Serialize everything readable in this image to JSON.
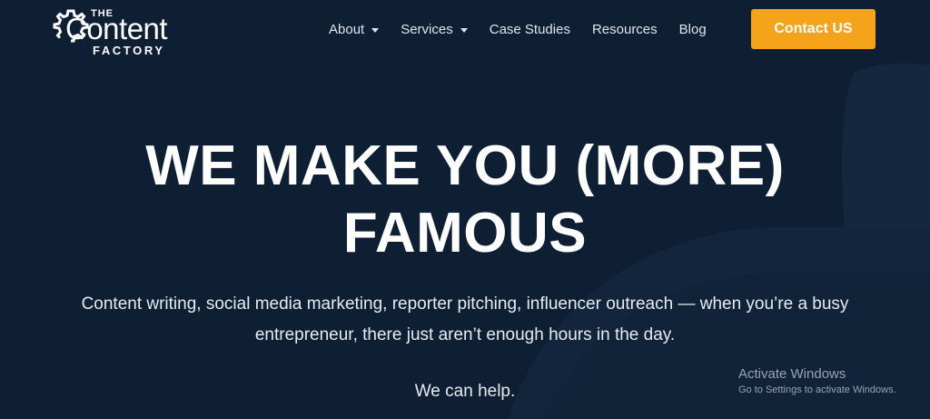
{
  "colors": {
    "background": "#0f1f33",
    "accent": "#f5a31b",
    "text": "#ffffff"
  },
  "logo": {
    "top_word": "THE",
    "main_word": "Content",
    "bottom_word": "FACTORY",
    "icon": "gear-icon"
  },
  "nav": {
    "items": [
      {
        "label": "About",
        "has_dropdown": true
      },
      {
        "label": "Services",
        "has_dropdown": true
      },
      {
        "label": "Case Studies",
        "has_dropdown": false
      },
      {
        "label": "Resources",
        "has_dropdown": false
      },
      {
        "label": "Blog",
        "has_dropdown": false
      }
    ],
    "cta_label": "Contact US"
  },
  "hero": {
    "title_line1": "WE MAKE YOU (MORE)",
    "title_line2": "FAMOUS",
    "subtitle_line1": "Content writing, social media marketing, reporter pitching, influencer outreach — when you’re a busy",
    "subtitle_line2": "entrepreneur, there just aren’t enough hours in the day.",
    "help_text": "We can help."
  },
  "watermark": {
    "title": "Activate Windows",
    "subtitle": "Go to Settings to activate Windows."
  }
}
